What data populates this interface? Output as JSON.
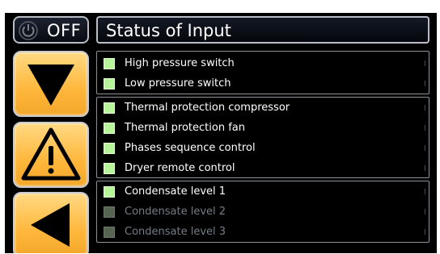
{
  "toggle": {
    "label": "OFF",
    "icon": "power-icon"
  },
  "title": "Status of Input",
  "nav_buttons": [
    {
      "icon": "arrow-down-icon"
    },
    {
      "icon": "warning-icon"
    },
    {
      "icon": "arrow-left-icon"
    }
  ],
  "colors": {
    "accent_orange": "#ffb73b",
    "check_active": "#b8f59a",
    "check_inactive": "#586452",
    "text_active": "#ffffff",
    "text_inactive": "#767c84"
  },
  "groups": [
    {
      "items": [
        {
          "label": "High pressure switch",
          "active": true
        },
        {
          "label": "Low pressure switch",
          "active": true
        }
      ]
    },
    {
      "items": [
        {
          "label": "Thermal protection compressor",
          "active": true
        },
        {
          "label": "Thermal protection fan",
          "active": true
        },
        {
          "label": "Phases sequence control",
          "active": true
        },
        {
          "label": "Dryer remote control",
          "active": true
        }
      ]
    },
    {
      "items": [
        {
          "label": "Condensate level 1",
          "active": true
        },
        {
          "label": "Condensate level 2",
          "active": false
        },
        {
          "label": "Condensate level 3",
          "active": false
        }
      ]
    }
  ]
}
